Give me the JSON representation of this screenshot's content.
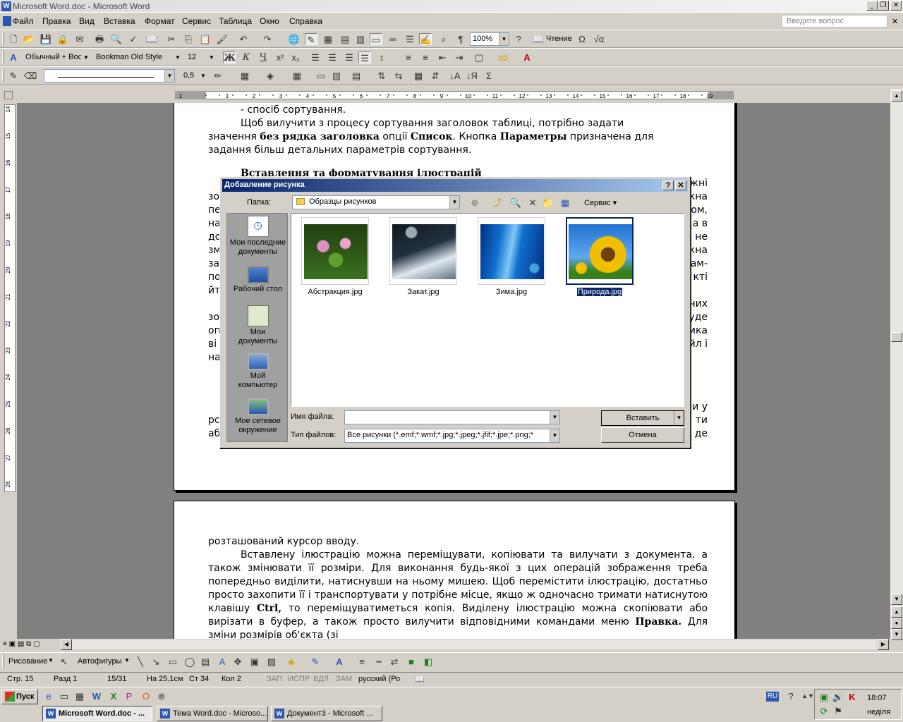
{
  "window": {
    "title": "Microsoft Word.doc - Microsoft Word",
    "app_icon": "W"
  },
  "menu": [
    "Файл",
    "Правка",
    "Вид",
    "Вставка",
    "Формат",
    "Сервис",
    "Таблица",
    "Окно",
    "Справка"
  ],
  "help_placeholder": "Введите вопрос",
  "toolbar_std": {
    "zoom": "100%",
    "read_label": "Чтение"
  },
  "toolbar_fmt": {
    "style": "Обычный + Boo",
    "font": "Bookman Old Style",
    "size": "12",
    "bold": "Ж",
    "italic": "К",
    "underline": "Ч"
  },
  "toolbar_tables": {
    "line_weight": "0,5"
  },
  "ruler": [
    "1",
    "1",
    "2",
    "3",
    "4",
    "5",
    "6",
    "7",
    "8",
    "9",
    "10",
    "11",
    "12",
    "13",
    "14",
    "15",
    "16",
    "17",
    "18",
    "19"
  ],
  "vruler": [
    "14",
    "15",
    "16",
    "17",
    "18",
    "19",
    "20",
    "21",
    "22",
    "23",
    "24",
    "25",
    "26",
    "27",
    "28"
  ],
  "page1": {
    "lines": [
      "- спосіб сортування.",
      "Щоб вилучити з процесу сортування заголовок таблиці, потрібно задати",
      "значення без рядка заголовка опції Список. Кнопка Параметры призначена для",
      "задання більш детальних параметрів сортування."
    ],
    "heading": "Вставлення та форматування ілюстрацій",
    "bottom_frag_1": "рс",
    "bottom_frag_2": "аб",
    "right_frag": [
      "жні",
      "кна",
      "ом,",
      "а в",
      "не",
      "кна",
      "ам-",
      "кті",
      "них",
      "уде",
      "ика",
      "йл і",
      "и у",
      "ти",
      "де"
    ],
    "left_frag": [
      "зо",
      "пе",
      "на",
      "до",
      "зм",
      "за",
      "по",
      "йт",
      "зо",
      "оп",
      "ві",
      "на"
    ]
  },
  "page2": {
    "paragraphs": [
      "розташований курсор вводу.",
      "Вставлену ілюстрацію можна переміщувати, копіювати та вилучати з документа, а також змінювати її розміри. Для виконання будь-якої з цих операцій зображення треба попередньо виділити, натиснувши на ньому мишею. Щоб перемістити ілюстрацію, достатньо просто захопити її і транспортувати у потрібне місце, якщо ж одночасно тримати натиснутою клавішу Ctrl, то переміщуватиметься копія. Виділену ілюстрацію можна скопіювати або вирізати в буфер, а також просто вилучити відповідними командами меню Правка. Для зміни розмірів об'єкта (зі"
    ]
  },
  "dialog": {
    "title": "Добавление рисунка",
    "folder_label": "Папка:",
    "folder_value": "Образцы рисунков",
    "service_label": "Сервис",
    "places": [
      {
        "line1": "Мои последние",
        "line2": "документы"
      },
      {
        "line1": "Рабочий стол",
        "line2": ""
      },
      {
        "line1": "Мои",
        "line2": "документы"
      },
      {
        "line1": "Мой",
        "line2": "компьютер"
      },
      {
        "line1": "Мое сетевое",
        "line2": "окружение"
      }
    ],
    "files": [
      "Абстракция.jpg",
      "Закат.jpg",
      "Зима.jpg",
      "Природа.jpg"
    ],
    "filename_label": "Имя файла:",
    "filename_value": "",
    "filetype_label": "Тип файлов:",
    "filetype_value": "Все рисунки (*.emf;*.wmf;*.jpg;*.jpeg;*.jfif;*.jpe;*.png;*",
    "insert_label": "Вставить",
    "cancel_label": "Отмена"
  },
  "drawbar": {
    "draw_label": "Рисование",
    "autoshapes_label": "Автофигуры"
  },
  "status": {
    "page": "Стр. 15",
    "section": "Разд 1",
    "pages": "15/31",
    "at": "На 25,1см",
    "line": "Ст 34",
    "col": "Кол 2",
    "rec": "ЗАП",
    "trk": "ИСПР",
    "ext": "ВДЛ",
    "ovr": "ЗАМ",
    "lang": "русский (Ро"
  },
  "taskbar": {
    "start": "Пуск",
    "tasks": [
      "Microsoft Word.doc - ...",
      "Тема Word.doc - Microso...",
      "Документ3 - Microsoft ..."
    ],
    "lang": "RU",
    "time": "18:07",
    "day": "неділя"
  }
}
